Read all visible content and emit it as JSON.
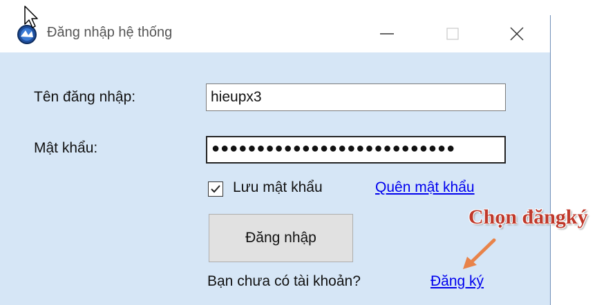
{
  "window": {
    "title": "Đăng nhập hệ thống"
  },
  "form": {
    "username_label": "Tên đăng nhập:",
    "username_value": "hieupx3",
    "password_label": "Mật khẩu:",
    "password_value": "●●●●●●●●●●●●●●●●●●●●●●●●●●●",
    "remember_label": "Lưu mật khẩu",
    "remember_checked": true,
    "forgot_label": "Quên mật khẩu",
    "login_button": "Đăng nhập",
    "no_account_text": "Bạn chưa có tài khoản?",
    "register_link": "Đăng ký"
  },
  "annotation": {
    "text": "Chọn đăngký",
    "color": "#c0392b"
  },
  "colors": {
    "window_bg": "#d6e6f6",
    "link": "#0000ee"
  }
}
